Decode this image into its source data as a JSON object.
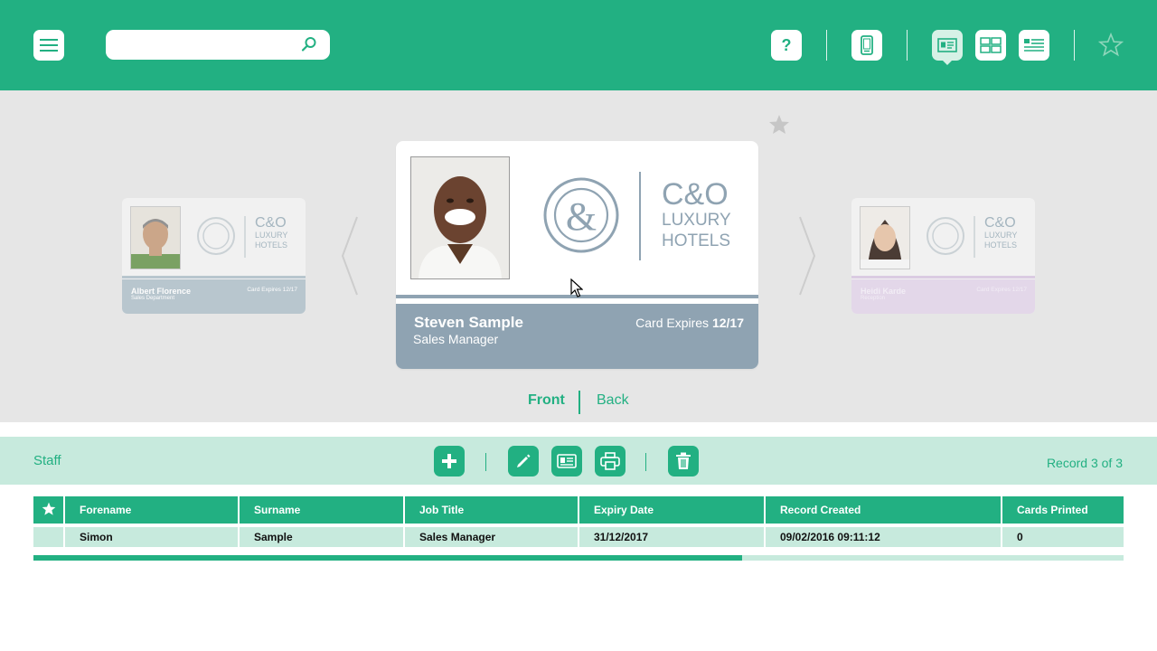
{
  "header": {
    "search": {
      "placeholder": "",
      "value": ""
    },
    "icons": [
      "menu-icon",
      "search-icon",
      "help-icon",
      "mobile-icon",
      "card-view-icon",
      "grid-view-icon",
      "list-view-icon",
      "star-outline-icon"
    ],
    "help_label": "?"
  },
  "carousel": {
    "prev_card": {
      "name": "Albert Florence",
      "department": "Sales Department",
      "expires": "Card Expires 12/17",
      "logo": {
        "line1": "C&O",
        "line2": "LUXURY",
        "line3": "HOTELS"
      }
    },
    "current_card": {
      "name": "Steven Sample",
      "job_title": "Sales Manager",
      "expires_label": "Card Expires",
      "expires_value": "12/17",
      "logo": {
        "line1": "C&O",
        "line2": "LUXURY",
        "line3": "HOTELS"
      }
    },
    "next_card": {
      "name": "Heidi Karde",
      "department": "Reception",
      "expires": "Card Expires 12/17",
      "logo": {
        "line1": "C&O",
        "line2": "LUXURY",
        "line3": "HOTELS"
      }
    },
    "side_toggle": {
      "front": "Front",
      "back": "Back",
      "active": "Front"
    }
  },
  "toolbar": {
    "section_label": "Staff",
    "record_label": "Record 3 of 3",
    "icons": [
      "add-icon",
      "edit-icon",
      "id-card-icon",
      "print-icon",
      "trash-icon"
    ]
  },
  "table": {
    "columns": [
      "Forename",
      "Surname",
      "Job Title",
      "Expiry Date",
      "Record Created",
      "Cards Printed"
    ],
    "rows": [
      [
        "Simon",
        "Sample",
        "Sales Manager",
        "31/12/2017",
        "09/02/2016 09:11:12",
        "0"
      ]
    ],
    "scroll_fraction": 0.65
  },
  "colors": {
    "accent": "#22b082",
    "light_accent": "#c7eadd",
    "stage_bg": "#e6e6e6",
    "card_strip": "#8fa3b2",
    "next_card_strip": "#d9c9e2"
  }
}
